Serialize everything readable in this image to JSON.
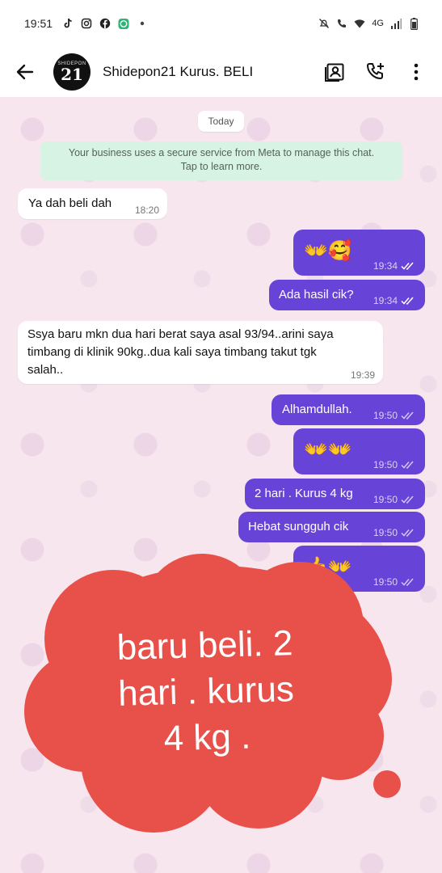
{
  "status_bar": {
    "time": "19:51",
    "notification_icons": [
      "tiktok-icon",
      "instagram-icon",
      "facebook-icon",
      "messenger-app-icon",
      "dot-icon"
    ],
    "network": "4G",
    "system_icons": [
      "mute-icon",
      "wifi-call-icon",
      "wifi-icon",
      "signal-icon",
      "battery-icon"
    ]
  },
  "app_bar": {
    "avatar_number": "21",
    "avatar_text": "SHIDEPON",
    "title": "Shidepon21 Kurus. BELI",
    "actions": [
      "contact-card-icon",
      "add-call-icon",
      "more-vert-icon"
    ]
  },
  "chat": {
    "date_chip": "Today",
    "system_note": {
      "line1": "Your business uses a secure service from Meta to manage this chat.",
      "line2": "Tap to learn more."
    },
    "messages": [
      {
        "dir": "in",
        "text": "Ya dah beli dah",
        "time": "18:20"
      },
      {
        "dir": "out",
        "text": "👐🥰",
        "time": "19:34",
        "read": true
      },
      {
        "dir": "out",
        "text": "Ada hasil cik?",
        "time": "19:34",
        "read": true
      },
      {
        "dir": "in",
        "lines": [
          "Ssya baru mkn dua hari berat saya asal 93/94..arini saya",
          "timbang di klinik 90kg..dua kali saya timbang takut tgk",
          "salah.."
        ],
        "time": "19:39"
      },
      {
        "dir": "out",
        "text": "Alhamdullah.",
        "time": "19:50",
        "read": false
      },
      {
        "dir": "out",
        "text": "👐👐",
        "time": "19:50",
        "read": false
      },
      {
        "dir": "out",
        "text": "2 hari . Kurus 4 kg",
        "time": "19:50",
        "read": false
      },
      {
        "dir": "out",
        "text": "Hebat sungguh cik",
        "time": "19:50",
        "read": false
      },
      {
        "dir": "out",
        "text": "👍👐",
        "time": "19:50",
        "read": false
      }
    ]
  },
  "overlay": {
    "lines": [
      "baru beli. 2",
      "hari . kurus",
      "4 kg ."
    ],
    "color": "#e8504a"
  },
  "colors": {
    "outgoing": "#6843d8",
    "incoming": "#ffffff",
    "background": "#f8e6ee",
    "system_note": "#d6f3e3"
  }
}
